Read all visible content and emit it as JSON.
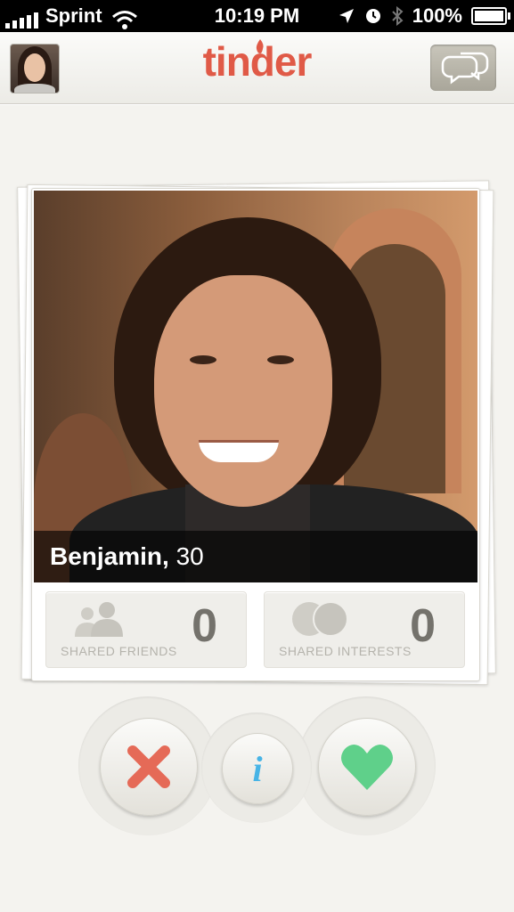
{
  "status_bar": {
    "carrier": "Sprint",
    "time": "10:19 PM",
    "battery_percent": "100%",
    "signal_bars": 5,
    "icons": [
      "signal-icon",
      "wifi-icon",
      "location-icon",
      "alarm-icon",
      "bluetooth-icon",
      "battery-icon"
    ]
  },
  "header": {
    "logo": "tinder",
    "icons": {
      "avatar": "profile-avatar",
      "chat": "chat-bubbles-icon"
    }
  },
  "profile": {
    "name": "Benjamin,",
    "age": "30"
  },
  "stats": {
    "shared_friends": {
      "label": "SHARED FRIENDS",
      "count": "0",
      "icon": "people-icon"
    },
    "shared_interests": {
      "label": "SHARED INTERESTS",
      "count": "0",
      "icon": "interests-circles-icon"
    }
  },
  "actions": {
    "dislike_icon": "x-icon",
    "info_glyph": "i",
    "like_icon": "heart-icon"
  },
  "colors": {
    "brand": "#e05a47",
    "dislike": "#e56a57",
    "info": "#47b4e6",
    "like": "#5fd08a",
    "background": "#f4f3ef"
  }
}
